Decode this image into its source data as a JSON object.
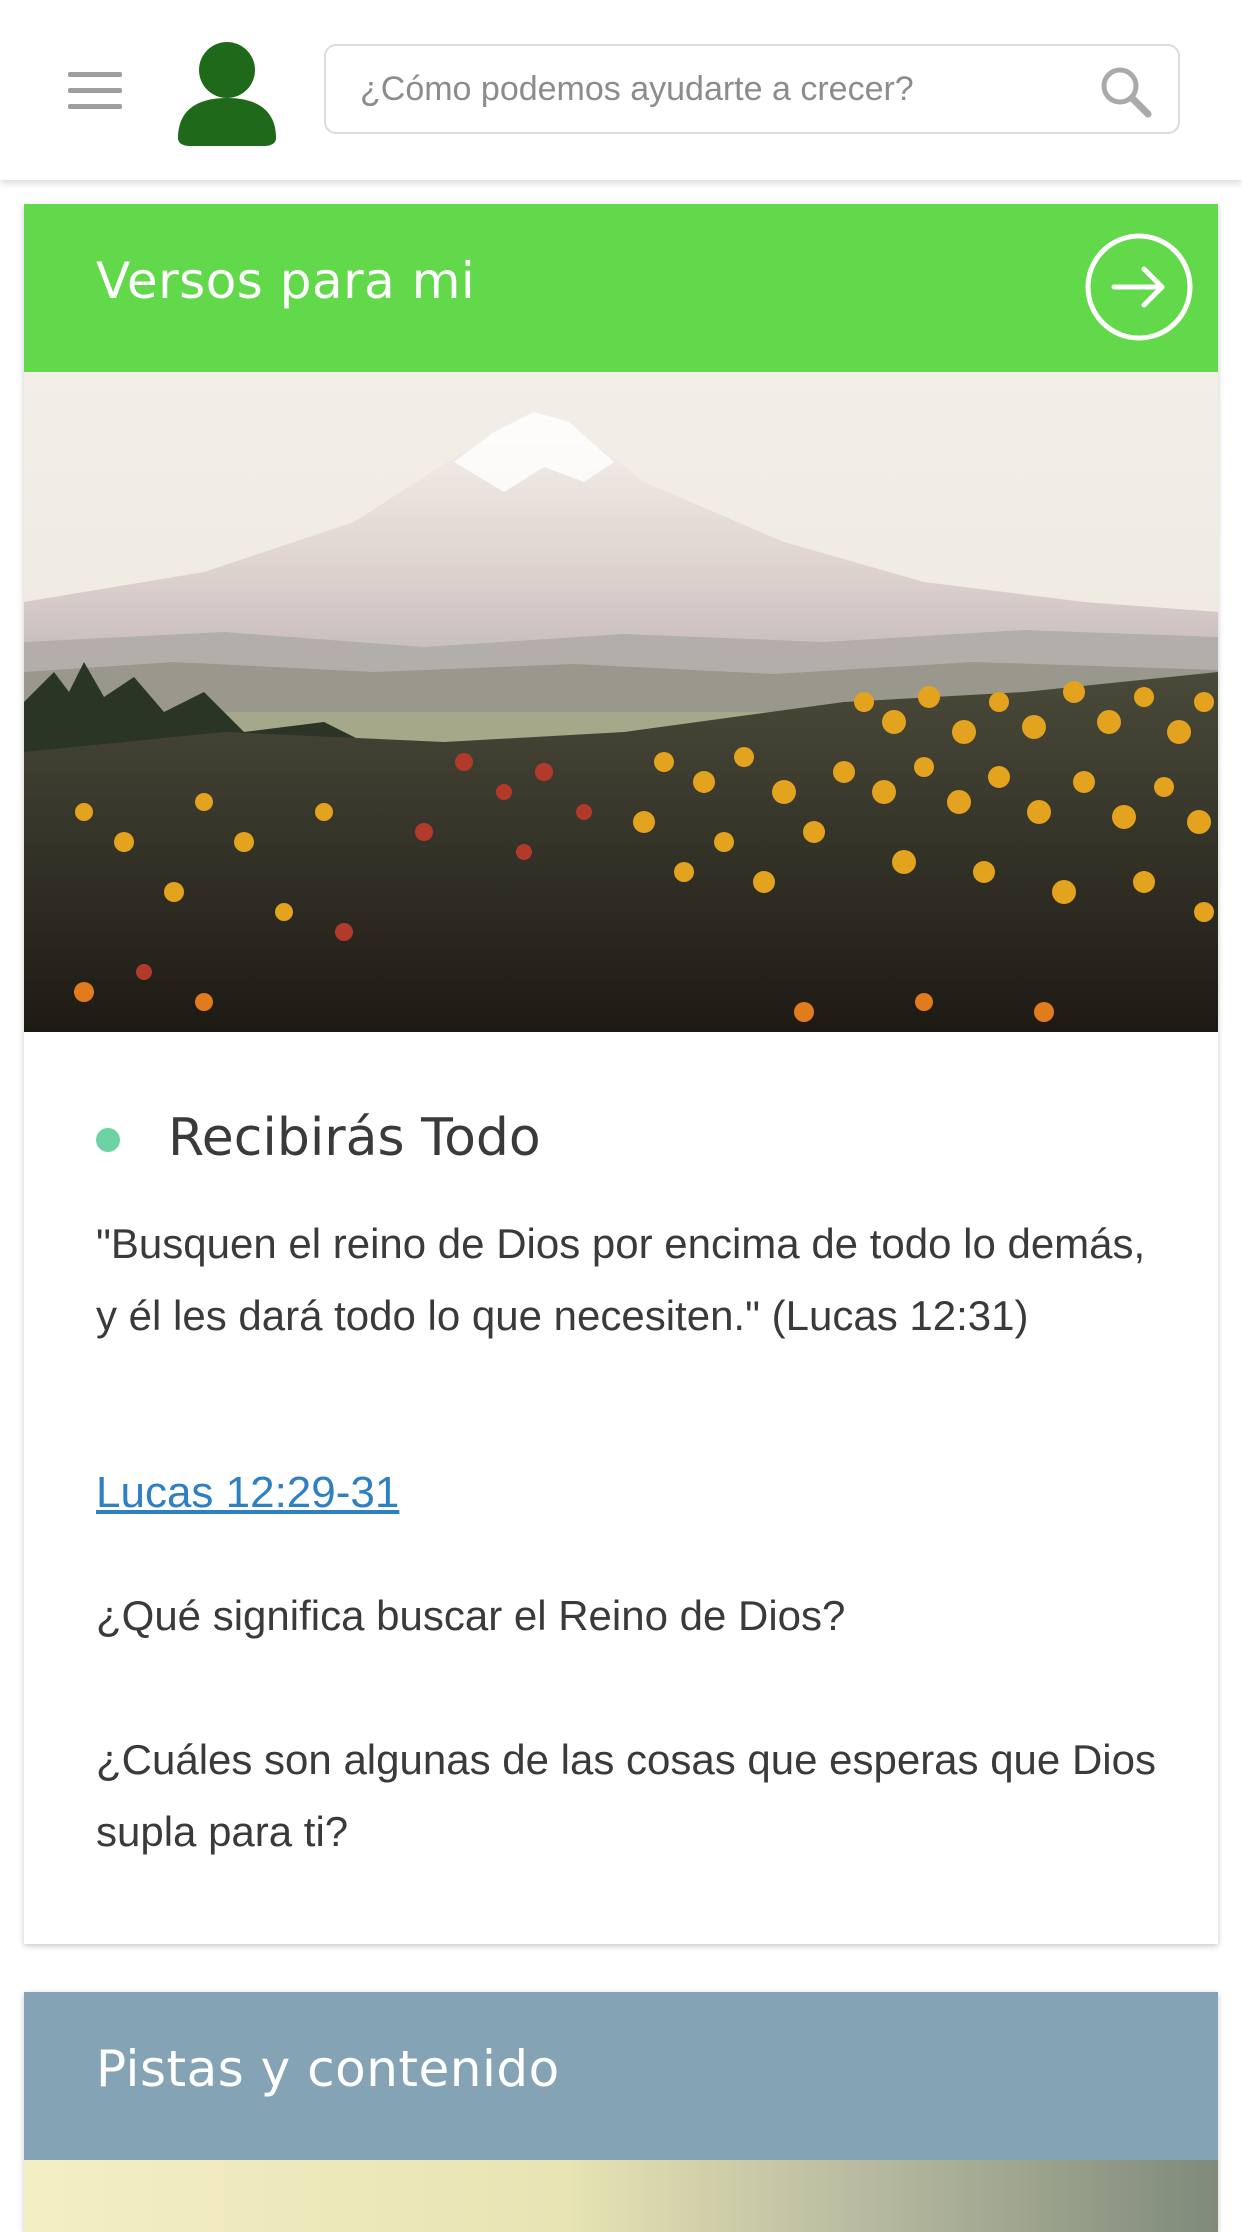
{
  "header": {
    "search_placeholder": "¿Cómo podemos ayudarte a crecer?",
    "menu_icon": "hamburger-menu-icon",
    "avatar_icon": "user-avatar-icon",
    "search_icon": "search-icon"
  },
  "verses_card": {
    "title": "Versos para mi",
    "header_color": "#62d94a",
    "arrow_icon": "arrow-right-circle-icon",
    "image": "mountain-flower-field-photo",
    "bullet_color": "#6cd4a4",
    "verse_title": "Recibirás Todo",
    "verse_text": "\"Busquen el reino de Dios por encima de todo lo demás, y él les dará todo lo que necesiten.\" (Lucas 12:31)",
    "link_text": "Lucas 12:29-31",
    "question_1": "¿Qué significa buscar el Reino de Dios?",
    "question_2": "¿Cuáles son algunas de las cosas que esperas que Dios supla para ti?"
  },
  "tracks_card": {
    "title": "Pistas y contenido",
    "header_color": "#84a4b5"
  }
}
